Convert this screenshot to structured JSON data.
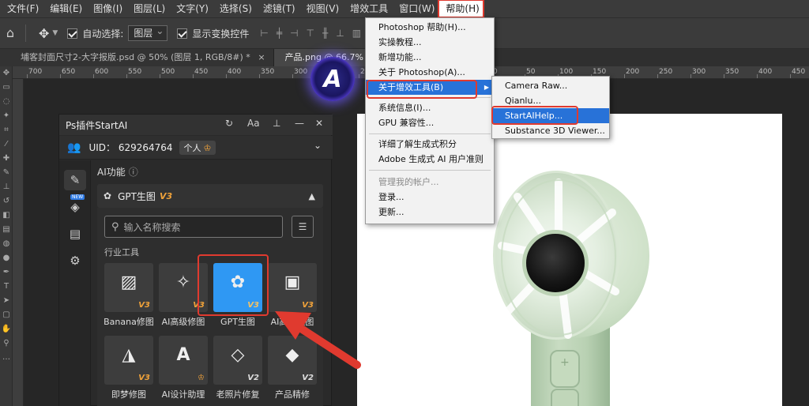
{
  "menubar": {
    "items": [
      "文件(F)",
      "编辑(E)",
      "图像(I)",
      "图层(L)",
      "文字(Y)",
      "选择(S)",
      "滤镜(T)",
      "视图(V)",
      "增效工具",
      "窗口(W)",
      "帮助(H)"
    ]
  },
  "options": {
    "auto_select_label": "自动选择:",
    "auto_select_value": "图层",
    "show_transform_label": "显示变换控件"
  },
  "tabs": [
    {
      "label": "埔客封面尺寸2-大字报版.psd @ 50% (图层 1, RGB/8#) *",
      "close": "×"
    },
    {
      "label": "产品.png @ 66.7% (详情页, RG"
    }
  ],
  "ruler": {
    "labels": [
      "700",
      "650",
      "600",
      "550",
      "500",
      "450",
      "400",
      "350",
      "300",
      "250",
      "200",
      "150",
      "100",
      "50",
      "0",
      "50",
      "100",
      "150",
      "200",
      "250",
      "300",
      "350",
      "400",
      "450"
    ]
  },
  "help_menu": {
    "items": [
      {
        "label": "Photoshop 帮助(H)..."
      },
      {
        "label": "实操教程..."
      },
      {
        "label": "新增功能..."
      },
      {
        "label": "关于 Photoshop(A)..."
      },
      {
        "label": "关于增效工具(B)"
      },
      {
        "label": "系统信息(I)..."
      },
      {
        "label": "GPU 兼容性..."
      },
      {
        "label": "详细了解生成式积分"
      },
      {
        "label": "Adobe 生成式 AI 用户准则"
      },
      {
        "label": "管理我的帐户..."
      },
      {
        "label": "登录..."
      },
      {
        "label": "更新..."
      }
    ],
    "submenu_arrow": "▶"
  },
  "plugins_submenu": {
    "items": [
      {
        "label": "Camera Raw..."
      },
      {
        "label": "Qianlu..."
      },
      {
        "label": "StartAIHelp..."
      },
      {
        "label": "Substance 3D Viewer..."
      }
    ]
  },
  "panel": {
    "title": "Ps插件StartAI",
    "uid": "UID： 629264764",
    "account_badge": "个人",
    "badge_crown": "♔",
    "new_badge": "NEW",
    "section": "AI功能",
    "section_info": "ⓘ",
    "gpt_title": "GPT生图",
    "gpt_version": "V3",
    "search_placeholder": "输入名称搜索",
    "category": "行业工具",
    "tools": [
      {
        "label": "Banana修图",
        "version": "V3"
      },
      {
        "label": "AI高级修图",
        "version": "V3"
      },
      {
        "label": "GPT生图",
        "version": "V3"
      },
      {
        "label": "AI高级液图",
        "version": "V3"
      },
      {
        "label": "即梦修图",
        "version": "V3"
      },
      {
        "label": "AI设计助理",
        "version": "♔"
      },
      {
        "label": "老照片修复",
        "version": "V2"
      },
      {
        "label": "产品精修",
        "version": "V2"
      }
    ]
  },
  "colors": {
    "highlight_red": "#e03a2f",
    "menu_selection": "#2872d8",
    "tool_selected": "#2f98f3",
    "version_orange": "#f0a23a"
  }
}
